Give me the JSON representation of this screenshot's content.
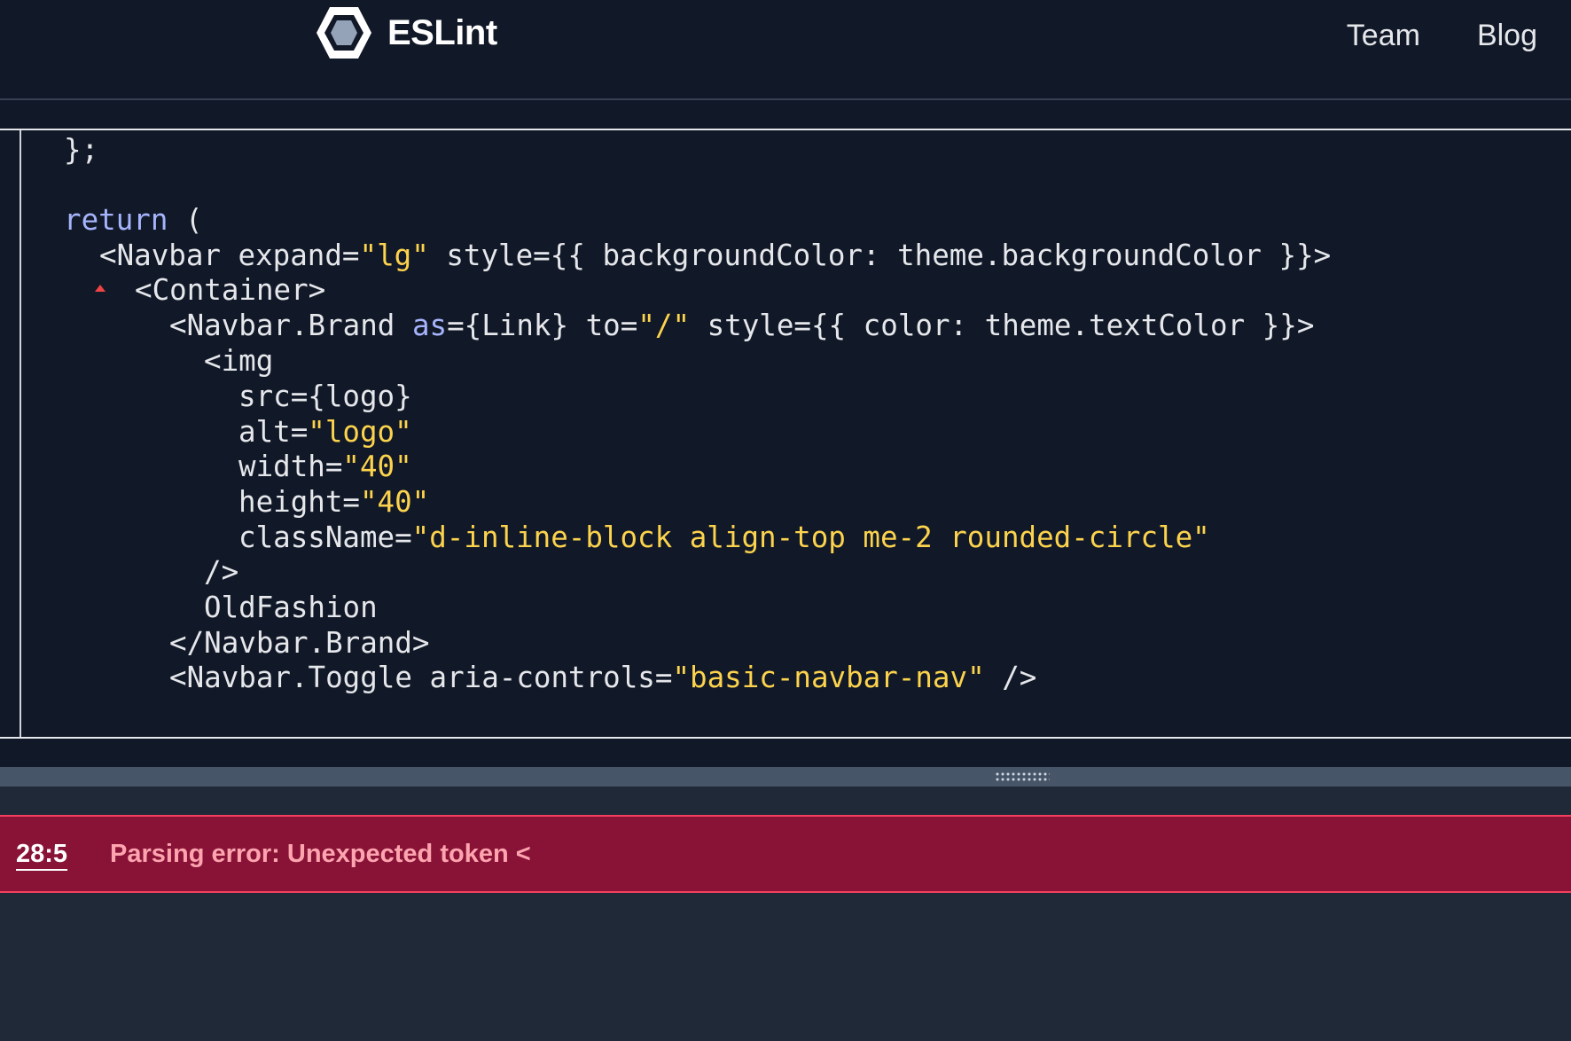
{
  "header": {
    "brand": "ESLint",
    "nav": [
      "Team",
      "Blog"
    ]
  },
  "editor": {
    "lines": [
      [
        {
          "t": "};",
          "c": ""
        }
      ],
      [
        {
          "t": "return",
          "c": "kw"
        },
        {
          "t": " (",
          "c": ""
        }
      ],
      [
        {
          "t": "<Navbar expand=",
          "c": ""
        },
        {
          "t": "\"lg\"",
          "c": "str"
        },
        {
          "t": " style={{ backgroundColor: theme.backgroundColor }}>",
          "c": ""
        }
      ],
      [
        {
          "t": "<Container>",
          "c": ""
        }
      ],
      [
        {
          "t": "<Navbar.Brand ",
          "c": ""
        },
        {
          "t": "as",
          "c": "kw"
        },
        {
          "t": "={Link} to=",
          "c": ""
        },
        {
          "t": "\"/\"",
          "c": "str"
        },
        {
          "t": " style={{ color: theme.textColor }}>",
          "c": ""
        }
      ],
      [
        {
          "t": "<img",
          "c": ""
        }
      ],
      [
        {
          "t": "src={logo}",
          "c": ""
        }
      ],
      [
        {
          "t": "alt=",
          "c": ""
        },
        {
          "t": "\"logo\"",
          "c": "str"
        }
      ],
      [
        {
          "t": "width=",
          "c": ""
        },
        {
          "t": "\"40\"",
          "c": "str"
        }
      ],
      [
        {
          "t": "height=",
          "c": ""
        },
        {
          "t": "\"40\"",
          "c": "str"
        }
      ],
      [
        {
          "t": "className=",
          "c": ""
        },
        {
          "t": "\"d-inline-block align-top me-2 rounded-circle\"",
          "c": "str"
        }
      ],
      [
        {
          "t": "/>",
          "c": ""
        }
      ],
      [
        {
          "t": "OldFashion",
          "c": ""
        }
      ],
      [
        {
          "t": "</Navbar.Brand>",
          "c": ""
        }
      ],
      [
        {
          "t": "<Navbar.Toggle aria-controls=",
          "c": ""
        },
        {
          "t": "\"basic-navbar-nav\"",
          "c": "str"
        },
        {
          "t": " />",
          "c": ""
        }
      ]
    ]
  },
  "messages": {
    "error_position": "28:5",
    "error_message": "Parsing error: Unexpected token <"
  },
  "colors": {
    "background": "#111827",
    "keyword": "#a5b4fc",
    "string": "#fcd34d",
    "error_bg": "#881337",
    "error_text": "#fda4af"
  }
}
